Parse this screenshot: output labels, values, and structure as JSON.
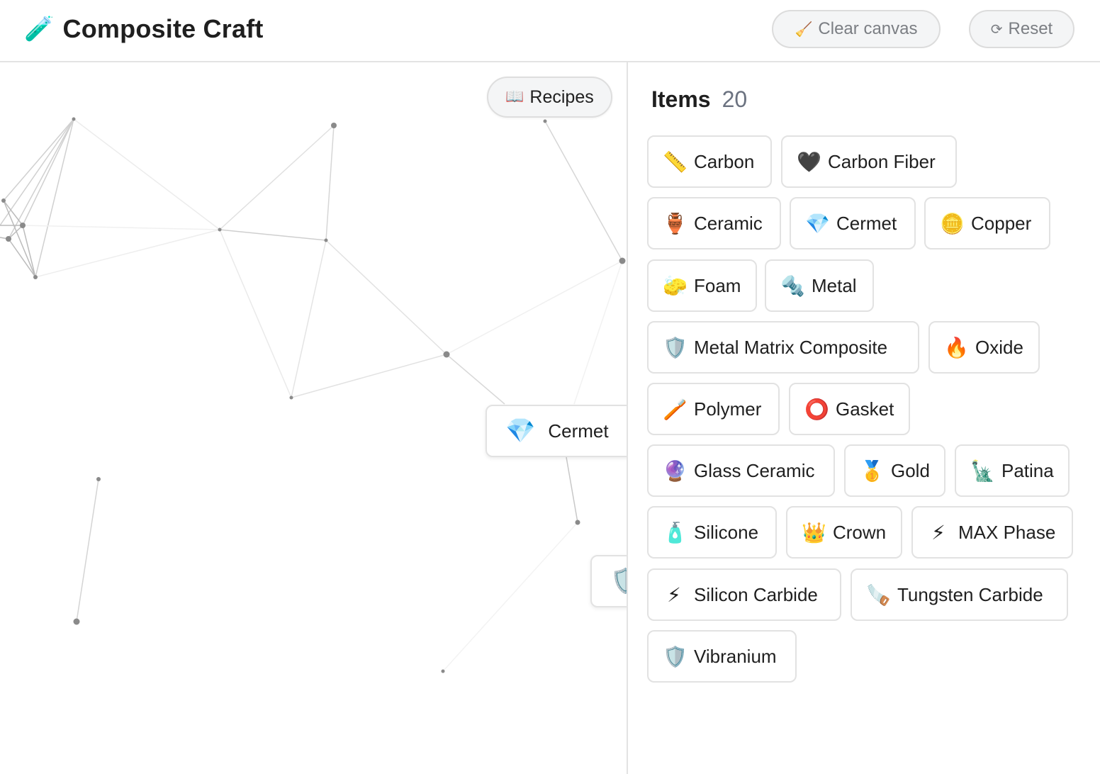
{
  "header": {
    "icon": "test-tube-icon",
    "icon_glyph": "🧪",
    "title": "Composite Craft",
    "clear_button": {
      "icon": "broom-icon",
      "icon_glyph": "🧹",
      "label": "Clear canvas"
    },
    "reset_button": {
      "icon": "refresh-icon",
      "icon_glyph": "⟳",
      "label": "Reset"
    }
  },
  "canvas": {
    "recipes_button": {
      "icon": "book-icon",
      "icon_glyph": "📖",
      "label": "Recipes"
    },
    "placed_items": [
      {
        "name": "Cermet",
        "icon": "gem-icon",
        "icon_glyph": "💎"
      },
      {
        "name": "",
        "icon": "shield-icon",
        "icon_glyph": "🛡️"
      }
    ]
  },
  "sidebar": {
    "title": "Items",
    "count": "20",
    "items": [
      {
        "label": "Carbon",
        "icon": "ruler-icon",
        "icon_glyph": "📏"
      },
      {
        "label": "Carbon Fiber",
        "icon": "black-heart-icon",
        "icon_glyph": "🖤"
      },
      {
        "label": "Ceramic",
        "icon": "amphora-icon",
        "icon_glyph": "🏺"
      },
      {
        "label": "Cermet",
        "icon": "gem-icon",
        "icon_glyph": "💎"
      },
      {
        "label": "Copper",
        "icon": "coin-icon",
        "icon_glyph": "🪙"
      },
      {
        "label": "Foam",
        "icon": "sponge-icon",
        "icon_glyph": "🧽"
      },
      {
        "label": "Metal",
        "icon": "nut-and-bolt-icon",
        "icon_glyph": "🔩"
      },
      {
        "label": "Metal Matrix Composite",
        "icon": "shield-icon",
        "icon_glyph": "🛡️"
      },
      {
        "label": "Oxide",
        "icon": "fire-icon",
        "icon_glyph": "🔥"
      },
      {
        "label": "Polymer",
        "icon": "toothbrush-icon",
        "icon_glyph": "🪥"
      },
      {
        "label": "Gasket",
        "icon": "ring-icon",
        "icon_glyph": "⭕"
      },
      {
        "label": "Glass Ceramic",
        "icon": "crystal-ball-icon",
        "icon_glyph": "🔮"
      },
      {
        "label": "Gold",
        "icon": "medal-icon",
        "icon_glyph": "🥇"
      },
      {
        "label": "Patina",
        "icon": "statue-of-liberty-icon",
        "icon_glyph": "🗽"
      },
      {
        "label": "Silicone",
        "icon": "lotion-bottle-icon",
        "icon_glyph": "🧴"
      },
      {
        "label": "Crown",
        "icon": "crown-icon",
        "icon_glyph": "👑"
      },
      {
        "label": "MAX Phase",
        "icon": "lightning-icon",
        "icon_glyph": "⚡"
      },
      {
        "label": "Silicon Carbide",
        "icon": "lightning-icon",
        "icon_glyph": "⚡"
      },
      {
        "label": "Tungsten Carbide",
        "icon": "saw-icon",
        "icon_glyph": "🪚"
      },
      {
        "label": "Vibranium",
        "icon": "shield-icon",
        "icon_glyph": "🛡️"
      }
    ]
  }
}
